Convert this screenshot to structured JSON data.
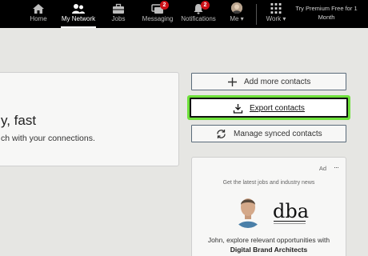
{
  "nav": {
    "home": "Home",
    "network": "My Network",
    "jobs": "Jobs",
    "messaging": "Messaging",
    "messaging_badge": "2",
    "notifications": "Notifications",
    "notifications_badge": "2",
    "me": "Me",
    "work": "Work",
    "premium": "Try Premium Free for 1 Month"
  },
  "main": {
    "headline": "y, fast",
    "subline": "ch with your connections."
  },
  "actions": {
    "add": "Add more contacts",
    "export": "Export contacts",
    "manage": "Manage synced contacts"
  },
  "ad": {
    "label": "Ad",
    "more": "···",
    "tagline": "Get the latest jobs and industry news",
    "logo_text": "dba",
    "text": "John, explore relevant opportunities with",
    "company": "Digital Brand Architects"
  },
  "colors": {
    "nav_bg": "#000000",
    "highlight": "#6ee13a",
    "badge": "#cc1016"
  },
  "icons": [
    "home-icon",
    "network-icon",
    "jobs-icon",
    "messaging-icon",
    "notifications-icon",
    "avatar",
    "grid-icon",
    "plus-icon",
    "download-icon",
    "sync-icon"
  ]
}
